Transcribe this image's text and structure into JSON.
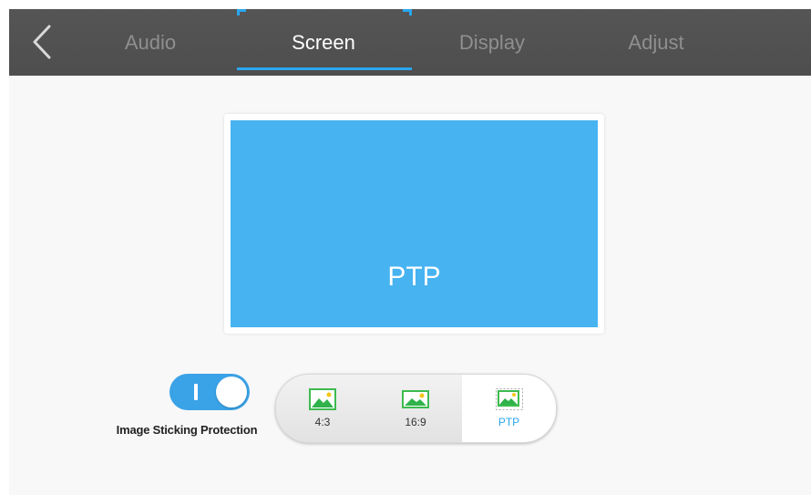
{
  "header": {
    "back_icon": "chevron-left-icon",
    "tabs": [
      {
        "label": "Audio",
        "active": false
      },
      {
        "label": "Screen",
        "active": true
      },
      {
        "label": "Display",
        "active": false
      },
      {
        "label": "Adjust",
        "active": false
      }
    ],
    "accent_color": "#2aa6ee"
  },
  "preview": {
    "label": "PTP",
    "color": "#47b3f1"
  },
  "image_sticking": {
    "label": "Image Sticking Protection",
    "enabled": true
  },
  "aspect_ratio": {
    "options": [
      {
        "label": "4:3",
        "icon": "image-icon"
      },
      {
        "label": "16:9",
        "icon": "image-icon"
      },
      {
        "label": "PTP",
        "icon": "image-fit-icon"
      }
    ],
    "selected": "PTP"
  }
}
